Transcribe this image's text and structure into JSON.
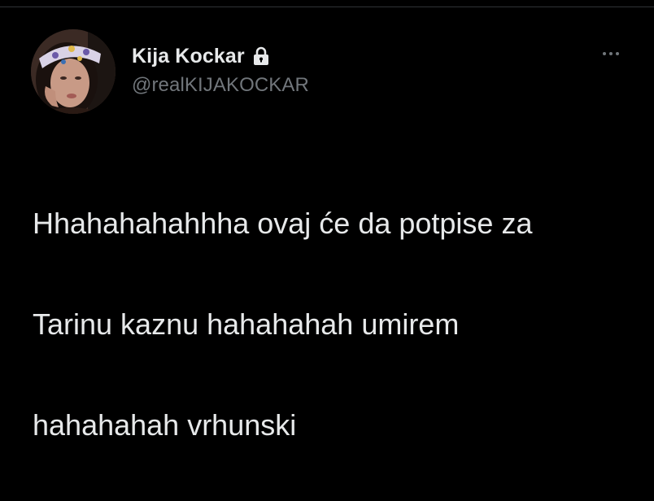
{
  "tweet": {
    "author": {
      "display_name": "Kija Kockar",
      "handle": "@realKIJAKOCKAR",
      "protected_icon": "lock-icon",
      "avatar": "profile-photo"
    },
    "more_icon": "more-horizontal-icon",
    "text_lines": [
      "Hhahahahahhha ovaj će da potpise za",
      "Tarinu kaznu hahahahah umirem",
      "hahahahah vrhunski"
    ]
  },
  "colors": {
    "background": "#000000",
    "primary_text": "#e7e9ea",
    "secondary_text": "#71767b"
  }
}
